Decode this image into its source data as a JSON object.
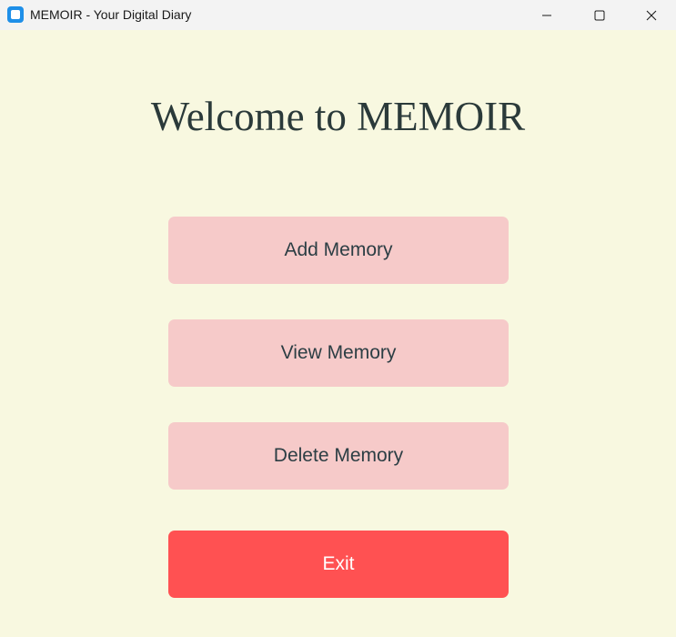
{
  "window": {
    "title": "MEMOIR - Your Digital Diary",
    "icon": "app-icon",
    "controls": [
      "minimize-icon",
      "maximize-icon",
      "close-icon"
    ]
  },
  "main": {
    "heading": "Welcome to MEMOIR",
    "buttons": {
      "add_label": "Add Memory",
      "view_label": "View Memory",
      "delete_label": "Delete Memory",
      "exit_label": "Exit"
    }
  },
  "colors": {
    "background": "#f8f8e0",
    "menu_button": "#f6cac9",
    "exit_button": "#ff5152",
    "heading_text": "#2b3a3a"
  }
}
